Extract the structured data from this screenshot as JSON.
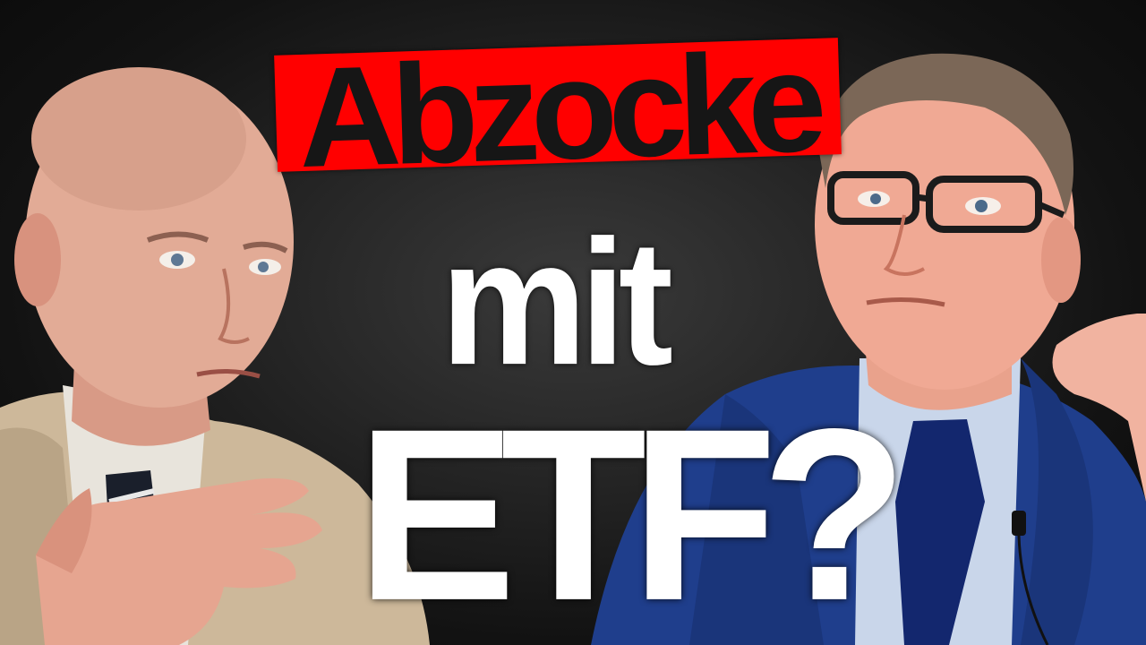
{
  "headline": {
    "line1": "Abzocke",
    "line2": "mit",
    "line3": "ETF?"
  },
  "colors": {
    "background": "#141414",
    "line1_bg": "#ff0000",
    "line1_text": "#161616",
    "text_white": "#ffffff",
    "left_jacket": "#cdb89a",
    "right_suit": "#1f3e8c"
  },
  "people": [
    {
      "name": "man-left"
    },
    {
      "name": "man-right"
    }
  ]
}
